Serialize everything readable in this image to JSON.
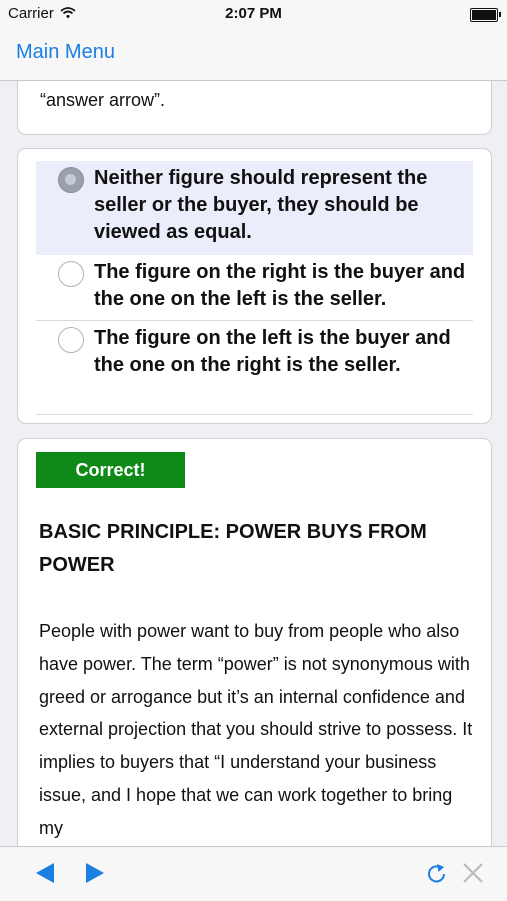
{
  "status_bar": {
    "carrier": "Carrier",
    "time": "2:07 PM"
  },
  "nav": {
    "back_label": "Main Menu"
  },
  "previous_card": {
    "text": "“answer arrow”."
  },
  "choices": [
    {
      "label": "Neither figure should represent the seller or the buyer, they should be viewed as equal.",
      "selected": true,
      "correct": true
    },
    {
      "label": "The figure on the right is the buyer and the one on the left is the seller.",
      "selected": false
    },
    {
      "label": "The figure on the left is the buyer and the one on the right is the seller.",
      "selected": false
    }
  ],
  "feedback": {
    "badge": "Correct!",
    "title": "BASIC PRINCIPLE: POWER BUYS FROM POWER",
    "body": "People with power want to buy from people who also have power. The term “power” is not synonymous with greed or arrogance but it’s an internal confidence and external projection that you should strive to possess. It implies to buyers that “I understand your business issue, and I hope that we can work together to bring my"
  },
  "toolbar": {
    "icons": [
      "back-arrow-icon",
      "forward-arrow-icon",
      "refresh-icon",
      "close-icon"
    ]
  },
  "colors": {
    "accent": "#1a7fe0",
    "correct": "#0f8a18",
    "selected_bg": "#ecedfb",
    "check": "#4cb04c"
  }
}
